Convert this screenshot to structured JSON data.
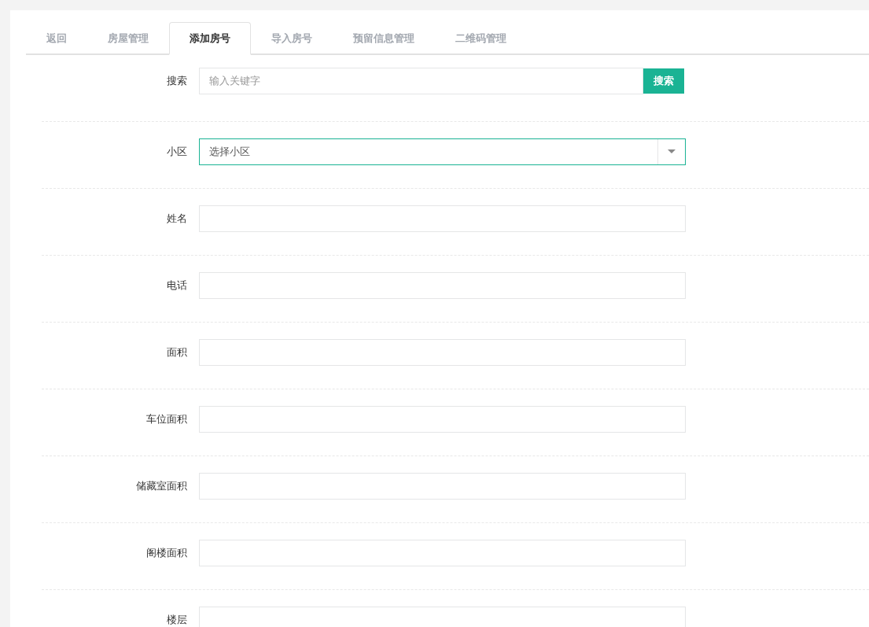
{
  "tabs": [
    {
      "label": "返回",
      "selected": false
    },
    {
      "label": "房屋管理",
      "selected": false
    },
    {
      "label": "添加房号",
      "selected": true
    },
    {
      "label": "导入房号",
      "selected": false
    },
    {
      "label": "预留信息管理",
      "selected": false
    },
    {
      "label": "二维码管理",
      "selected": false
    }
  ],
  "form": [
    {
      "kind": "search",
      "label": "搜索",
      "placeholder": "输入关键字",
      "button": "搜索"
    },
    {
      "kind": "select",
      "label": "小区",
      "value": "选择小区",
      "focused": true
    },
    {
      "kind": "text",
      "label": "姓名"
    },
    {
      "kind": "text",
      "label": "电话"
    },
    {
      "kind": "text",
      "label": "面积"
    },
    {
      "kind": "text",
      "label": "车位面积"
    },
    {
      "kind": "text",
      "label": "储藏室面积"
    },
    {
      "kind": "text",
      "label": "阁楼面积"
    },
    {
      "kind": "text",
      "label": "楼层"
    }
  ]
}
